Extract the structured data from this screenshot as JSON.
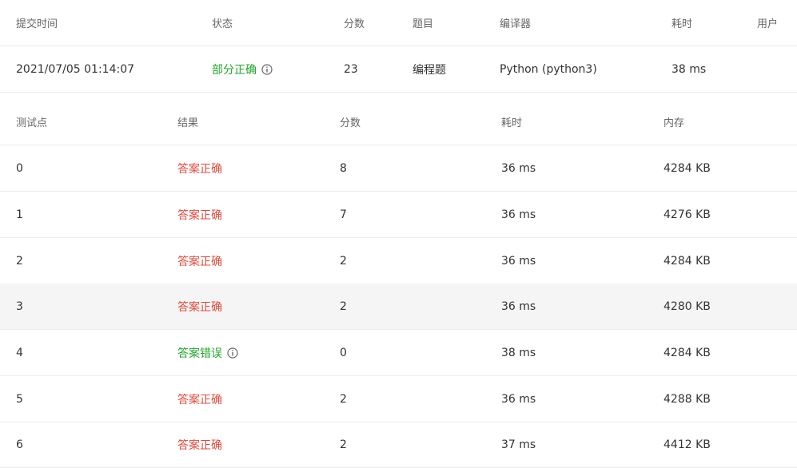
{
  "submission": {
    "headers": {
      "time": "提交时间",
      "status": "状态",
      "score": "分数",
      "problem": "题目",
      "compiler": "编译器",
      "elapsed": "耗时",
      "user": "用户"
    },
    "row": {
      "time": "2021/07/05 01:14:07",
      "status": "部分正确",
      "score": "23",
      "problem": "编程题",
      "compiler": "Python (python3)",
      "elapsed": "38 ms",
      "user": ""
    }
  },
  "tests": {
    "headers": {
      "case": "测试点",
      "result": "结果",
      "score": "分数",
      "elapsed": "耗时",
      "memory": "内存"
    },
    "rows": [
      {
        "case": "0",
        "result": "答案正确",
        "score": "8",
        "elapsed": "36 ms",
        "memory": "4284 KB"
      },
      {
        "case": "1",
        "result": "答案正确",
        "score": "7",
        "elapsed": "36 ms",
        "memory": "4276 KB"
      },
      {
        "case": "2",
        "result": "答案正确",
        "score": "2",
        "elapsed": "36 ms",
        "memory": "4284 KB"
      },
      {
        "case": "3",
        "result": "答案正确",
        "score": "2",
        "elapsed": "36 ms",
        "memory": "4280 KB"
      },
      {
        "case": "4",
        "result": "答案错误",
        "score": "0",
        "elapsed": "38 ms",
        "memory": "4284 KB"
      },
      {
        "case": "5",
        "result": "答案正确",
        "score": "2",
        "elapsed": "36 ms",
        "memory": "4288 KB"
      },
      {
        "case": "6",
        "result": "答案正确",
        "score": "2",
        "elapsed": "37 ms",
        "memory": "4412 KB"
      }
    ]
  },
  "colors": {
    "correct": "#e04b3c",
    "partial_or_wrong": "#23a52b",
    "hover_row": "#f5f5f5",
    "divider": "#ebebeb"
  },
  "icons": {
    "status_info": "info-circle-icon"
  }
}
